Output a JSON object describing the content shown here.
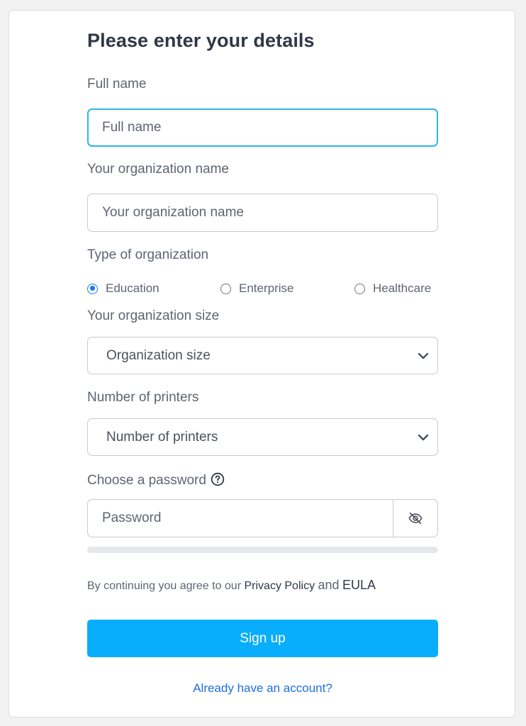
{
  "title": "Please enter your details",
  "full_name": {
    "label": "Full name",
    "placeholder": "Full name"
  },
  "org_name": {
    "label": "Your organization name",
    "placeholder": "Your organization name"
  },
  "org_type": {
    "label": "Type of organization",
    "options": [
      {
        "label": "Education",
        "checked": true
      },
      {
        "label": "Enterprise",
        "checked": false
      },
      {
        "label": "Healthcare",
        "checked": false
      }
    ]
  },
  "org_size": {
    "label": "Your organization size",
    "selected": "Organization size"
  },
  "printers": {
    "label": "Number of printers",
    "selected": "Number of printers"
  },
  "password": {
    "label": "Choose a password",
    "placeholder": "Password",
    "help_icon": "question-circle-icon",
    "toggle_icon": "eye-slash-icon"
  },
  "terms": {
    "prefix": "By continuing you agree to our",
    "privacy": "Privacy Policy",
    "and": "and",
    "eula": "EULA"
  },
  "signup_label": "Sign up",
  "login_link": "Already have an account?",
  "colors": {
    "accent": "#08aefc",
    "focus": "#2bb6ea",
    "link": "#1d6fe0",
    "radio": "#1877f2"
  }
}
